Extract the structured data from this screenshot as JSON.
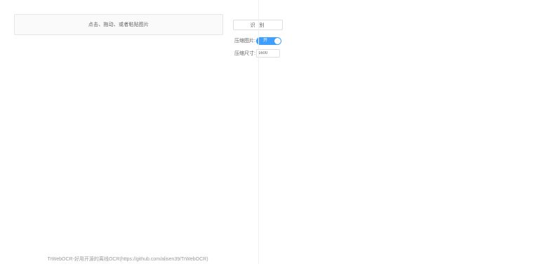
{
  "upload": {
    "prompt": "点击、拖动、或者粘贴图片"
  },
  "toolbar": {
    "recognize_label": "识 别"
  },
  "options": {
    "compress_label": "压缩图片:",
    "compress_switch_text": "开",
    "compress_enabled": true,
    "size_label": "压缩尺寸:",
    "size_value": "1600"
  },
  "footer": {
    "text": "TrWebOCR-好用开源的离线OCR",
    "link_text": "(https://github.com/alisen39/TrWebOCR)"
  },
  "colors": {
    "switch_on": "#409eff",
    "text": "#606266",
    "footer": "#9a9a9a"
  }
}
